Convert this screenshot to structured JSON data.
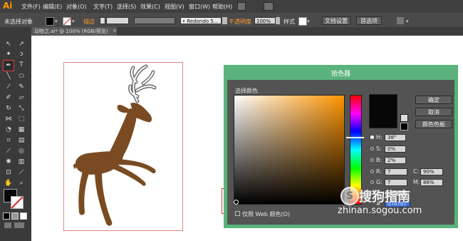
{
  "app": {
    "logo": "Ai"
  },
  "menubar": {
    "items": [
      "文件(F)",
      "编辑(E)",
      "对象(O)",
      "文字(T)",
      "选择(S)",
      "效果(C)",
      "视图(V)",
      "窗口(W)",
      "帮助(H)"
    ]
  },
  "controlbar": {
    "selection_status": "未选择对象",
    "stroke_label": "描边",
    "brush_style": "• Redondo 5...",
    "opacity_label": "不透明度",
    "opacity_value": "100%",
    "style_label": "样式",
    "doc_setup": "文档设置",
    "preferences": "首选项"
  },
  "document": {
    "tab_title": "动物之.ai* @ 100% (RGB/预览)"
  },
  "color_picker": {
    "title": "拾色器",
    "select_color_label": "选择颜色",
    "ok": "确定",
    "cancel": "取消",
    "swatches": "颜色色板",
    "h_label": "H:",
    "h_value": "38°",
    "s_label": "S:",
    "s_value": "0%",
    "b_label": "B:",
    "b_value": "2%",
    "r_label": "R:",
    "r_value": "7",
    "g_label": "G:",
    "g_value": "7",
    "bl_label": "B:",
    "bl_value": "7",
    "c_label": "C:",
    "c_value": "90%",
    "m_label": "M:",
    "m_value": "86%",
    "hex_label": "#",
    "hex_value": "070707",
    "web_only_label": "仅限 Web 颜色(O)",
    "current_color": "#070707"
  },
  "watermark": {
    "brand": "搜狗指南",
    "url": "zhinan.sogou.com"
  },
  "colors": {
    "deer": "#7a4b22",
    "antler_stroke": "#6d6d6d"
  }
}
